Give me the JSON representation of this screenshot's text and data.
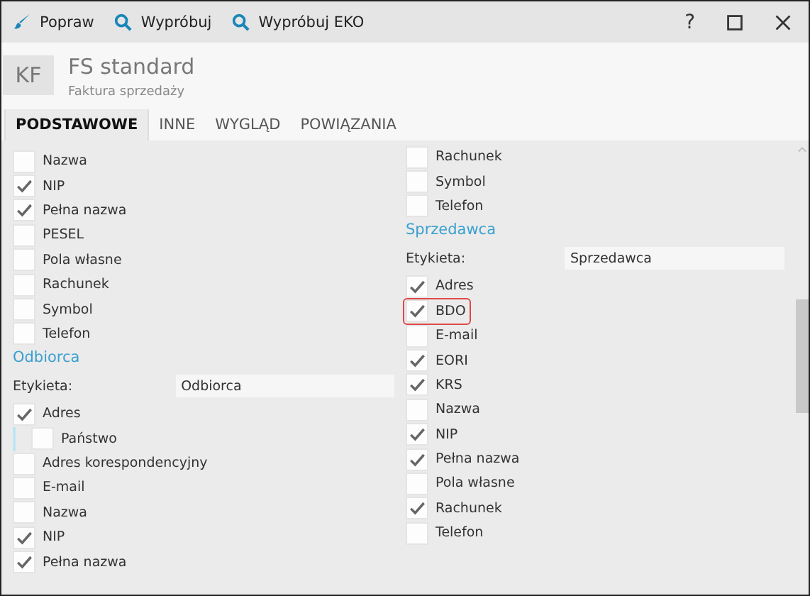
{
  "toolbar": [
    {
      "kind": "brush",
      "label": "Popraw"
    },
    {
      "kind": "search",
      "label": "Wypróbuj"
    },
    {
      "kind": "search",
      "label": "Wypróbuj EKO"
    }
  ],
  "help": "?",
  "header": {
    "badge": "KF",
    "title": "FS standard",
    "subtitle": "Faktura sprzedaży"
  },
  "tabs": [
    {
      "label": "PODSTAWOWE",
      "selected": true
    },
    {
      "label": "INNE",
      "selected": false
    },
    {
      "label": "WYGLĄD",
      "selected": false
    },
    {
      "label": "POWIĄZANIA",
      "selected": false
    }
  ],
  "columns": [
    {
      "blocks": [
        {
          "kind": "list",
          "items": [
            {
              "label": "Nazwa",
              "checked": false,
              "highlighted": false
            },
            {
              "label": "NIP",
              "checked": true,
              "highlighted": false
            },
            {
              "label": "Pełna nazwa",
              "checked": true,
              "highlighted": false
            },
            {
              "label": "PESEL",
              "checked": false,
              "highlighted": false
            },
            {
              "label": "Pola własne",
              "checked": false,
              "highlighted": false
            },
            {
              "label": "Rachunek",
              "checked": false,
              "highlighted": false
            },
            {
              "label": "Symbol",
              "checked": false,
              "highlighted": false
            },
            {
              "label": "Telefon",
              "checked": false,
              "highlighted": false
            }
          ]
        },
        {
          "kind": "section",
          "title": "Odbiorca"
        },
        {
          "kind": "field",
          "label": "Etykieta:",
          "value": "Odbiorca"
        },
        {
          "kind": "list",
          "items": [
            {
              "label": "Adres",
              "checked": true,
              "highlighted": false,
              "children": [
                {
                  "label": "Państwo",
                  "checked": false
                }
              ]
            },
            {
              "label": "Adres korespondencyjny",
              "checked": false,
              "highlighted": false
            },
            {
              "label": "E-mail",
              "checked": false,
              "highlighted": false
            },
            {
              "label": "Nazwa",
              "checked": false,
              "highlighted": false
            },
            {
              "label": "NIP",
              "checked": true,
              "highlighted": false
            },
            {
              "label": "Pełna nazwa",
              "checked": true,
              "highlighted": false
            }
          ]
        }
      ]
    },
    {
      "blocks": [
        {
          "kind": "list",
          "items": [
            {
              "label": "Rachunek",
              "checked": false,
              "highlighted": false
            },
            {
              "label": "Symbol",
              "checked": false,
              "highlighted": false
            },
            {
              "label": "Telefon",
              "checked": false,
              "highlighted": false
            }
          ]
        },
        {
          "kind": "section",
          "title": "Sprzedawca"
        },
        {
          "kind": "field",
          "label": "Etykieta:",
          "value": "Sprzedawca"
        },
        {
          "kind": "list",
          "items": [
            {
              "label": "Adres",
              "checked": true,
              "highlighted": false
            },
            {
              "label": "BDO",
              "checked": true,
              "highlighted": true
            },
            {
              "label": "E-mail",
              "checked": false,
              "highlighted": false
            },
            {
              "label": "EORI",
              "checked": true,
              "highlighted": false
            },
            {
              "label": "KRS",
              "checked": true,
              "highlighted": false
            },
            {
              "label": "Nazwa",
              "checked": false,
              "highlighted": false
            },
            {
              "label": "NIP",
              "checked": true,
              "highlighted": false
            },
            {
              "label": "Pełna nazwa",
              "checked": true,
              "highlighted": false
            },
            {
              "label": "Pola własne",
              "checked": false,
              "highlighted": false
            },
            {
              "label": "Rachunek",
              "checked": true,
              "highlighted": false
            },
            {
              "label": "Telefon",
              "checked": false,
              "highlighted": false
            }
          ]
        }
      ]
    }
  ]
}
